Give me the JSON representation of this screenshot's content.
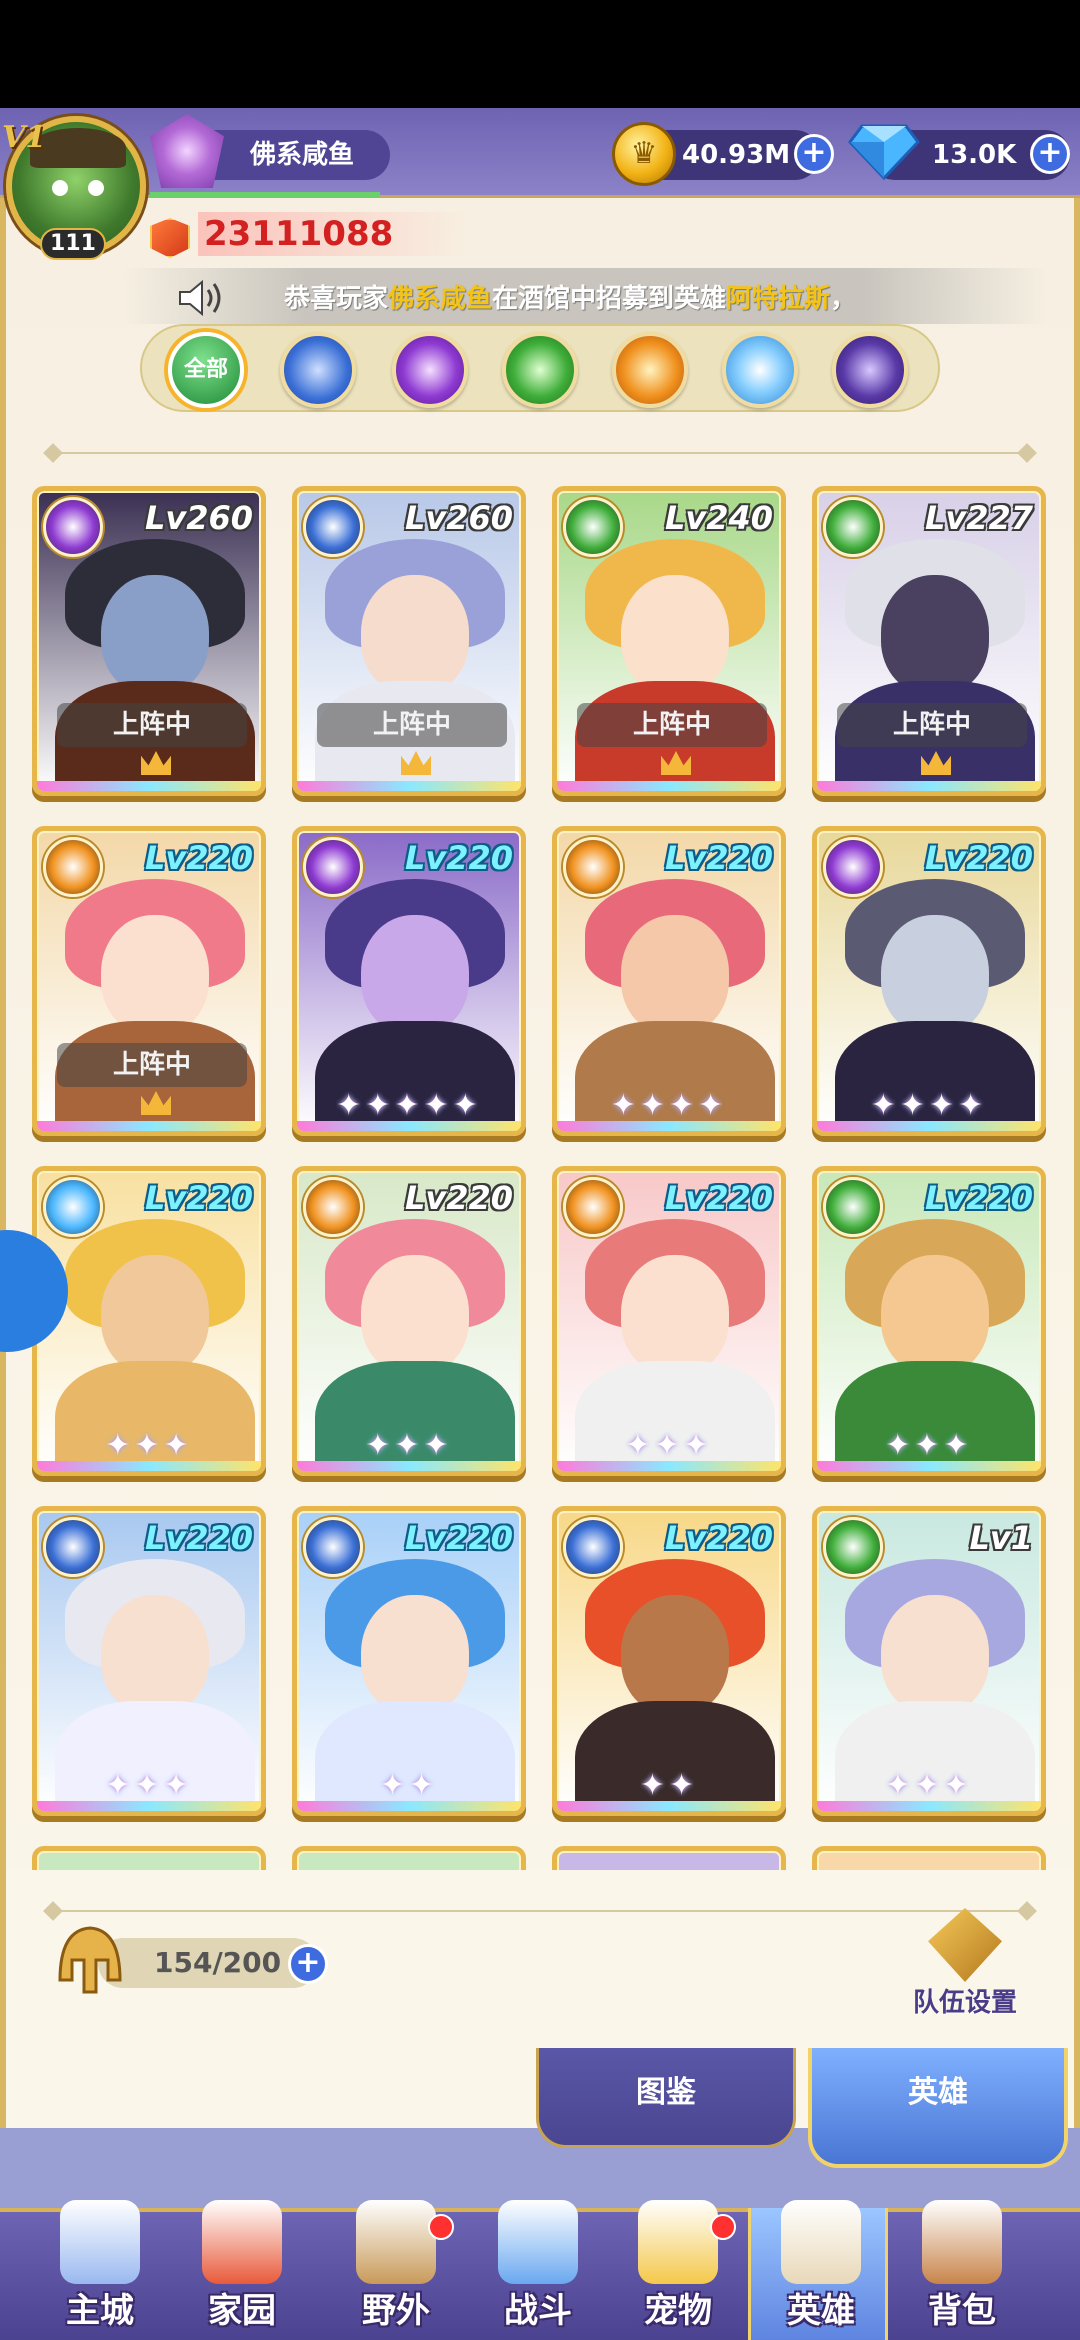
{
  "player": {
    "vip": "V1",
    "level": "111",
    "name": "佛系咸鱼",
    "power": "23111088"
  },
  "currency": {
    "gold": "40.93M",
    "gems": "13.0K"
  },
  "announcement": {
    "prefix": "恭喜玩家",
    "player": "佛系咸鱼",
    "middle": "在酒馆中招募到英雄",
    "hero": "阿特拉斯",
    "suffix": "，"
  },
  "filters": {
    "all_label": "全部",
    "items": [
      {
        "name": "all",
        "color": "#2fa84a"
      },
      {
        "name": "water",
        "color": "#3a6fd6"
      },
      {
        "name": "dark",
        "color": "#8e3ad2"
      },
      {
        "name": "nature",
        "color": "#3fae3a"
      },
      {
        "name": "fire",
        "color": "#f0911e"
      },
      {
        "name": "light",
        "color": "#4ab6ff"
      },
      {
        "name": "void",
        "color": "#5a3aa8"
      }
    ]
  },
  "deployed_label": "上阵中",
  "heroes": [
    {
      "level": "Lv260",
      "element": "dark",
      "deployed": true,
      "stars": "",
      "bg": "#3a2f52",
      "hair": "#2d2d3a",
      "skin": "#8a9fc8",
      "body": "#5a2a1a"
    },
    {
      "level": "Lv260",
      "element": "water",
      "deployed": true,
      "stars": "",
      "bg": "#b8c8e8",
      "hair": "#9aa0d8",
      "skin": "#f6dccc",
      "body": "#e8e8f0"
    },
    {
      "level": "Lv240",
      "element": "nature",
      "deployed": true,
      "stars": "",
      "bg": "#a8d888",
      "hair": "#f0b84a",
      "skin": "#fbe0cc",
      "body": "#c83a2a"
    },
    {
      "level": "Lv227",
      "element": "nature",
      "deployed": true,
      "stars": "",
      "bg": "#d8d0e8",
      "hair": "#e0e0e8",
      "skin": "#4a4060",
      "body": "#3a3068"
    },
    {
      "level": "Lv220",
      "element": "fire",
      "deployed": true,
      "stars": "",
      "bg": "#f3d8a8",
      "hair": "#f07a8a",
      "skin": "#fbe0d0",
      "body": "#a8643a"
    },
    {
      "level": "Lv220",
      "element": "dark",
      "deployed": false,
      "stars": "✦✦✦✦✦",
      "bg": "#8a6ac8",
      "hair": "#4a3a8a",
      "skin": "#c8a8e8",
      "body": "#2a2440"
    },
    {
      "level": "Lv220",
      "element": "fire",
      "deployed": false,
      "stars": "✦✦✦✦",
      "bg": "#f3d8a8",
      "hair": "#e86a7a",
      "skin": "#f4c8a8",
      "body": "#b07a4a"
    },
    {
      "level": "Lv220",
      "element": "dark",
      "deployed": false,
      "stars": "✦✦✦✦",
      "bg": "#e8d89a",
      "hair": "#5a5a72",
      "skin": "#c8d0e0",
      "body": "#2a2440"
    },
    {
      "level": "Lv220",
      "element": "light",
      "deployed": false,
      "stars": "✦✦✦",
      "bg": "#f8e0a0",
      "hair": "#f0c24a",
      "skin": "#f0c89a",
      "body": "#e8b868"
    },
    {
      "level": "Lv220",
      "element": "fire",
      "deployed": false,
      "stars": "✦✦✦",
      "bg": "#d8e8c8",
      "hair": "#f08a9a",
      "skin": "#fbe0d0",
      "body": "#3a8a6a"
    },
    {
      "level": "Lv220",
      "element": "fire",
      "deployed": false,
      "stars": "✦✦✦",
      "bg": "#f8c8c8",
      "hair": "#e87a7a",
      "skin": "#fbe0d0",
      "body": "#f0f0f0"
    },
    {
      "level": "Lv220",
      "element": "nature",
      "deployed": false,
      "stars": "✦✦✦",
      "bg": "#c8e8b8",
      "hair": "#d8a858",
      "skin": "#f4c890",
      "body": "#3a8a3a"
    },
    {
      "level": "Lv220",
      "element": "water",
      "deployed": false,
      "stars": "✦✦✦",
      "bg": "#a8c8f0",
      "hair": "#e8e8f0",
      "skin": "#f8e0d0",
      "body": "#f0f0ff"
    },
    {
      "level": "Lv220",
      "element": "water",
      "deployed": false,
      "stars": "✦✦",
      "bg": "#a8d0f8",
      "hair": "#4a9ae8",
      "skin": "#f8e0d0",
      "body": "#e0e8ff"
    },
    {
      "level": "Lv220",
      "element": "water",
      "deployed": false,
      "stars": "✦✦",
      "bg": "#f8d888",
      "hair": "#e8502a",
      "skin": "#b8784a",
      "body": "#3a2a2a"
    },
    {
      "level": "Lv1",
      "element": "nature",
      "deployed": false,
      "stars": "✦✦✦",
      "bg": "#c8e8e0",
      "hair": "#a8a8e0",
      "skin": "#f8e0d0",
      "body": "#f0f0f0"
    }
  ],
  "footer": {
    "capacity": "154/200",
    "team_setup_label": "队伍设置"
  },
  "subtabs": {
    "codex": "图鉴",
    "heroes": "英雄"
  },
  "nav": [
    {
      "label": "主城",
      "icon": "castle-icon",
      "color": "#9ab8f0",
      "badge": false,
      "active": false
    },
    {
      "label": "家园",
      "icon": "home-icon",
      "color": "#e85a3a",
      "badge": false,
      "active": false
    },
    {
      "label": "野外",
      "icon": "wilds-icon",
      "color": "#c89a5a",
      "badge": true,
      "active": false
    },
    {
      "label": "战斗",
      "icon": "battle-icon",
      "color": "#6aa8f0",
      "badge": false,
      "active": false
    },
    {
      "label": "宠物",
      "icon": "pet-icon",
      "color": "#f4c84a",
      "badge": true,
      "active": false
    },
    {
      "label": "英雄",
      "icon": "hero-book-icon",
      "color": "#e8d8b8",
      "badge": false,
      "active": true
    },
    {
      "label": "背包",
      "icon": "backpack-icon",
      "color": "#c8844a",
      "badge": false,
      "active": false
    }
  ]
}
